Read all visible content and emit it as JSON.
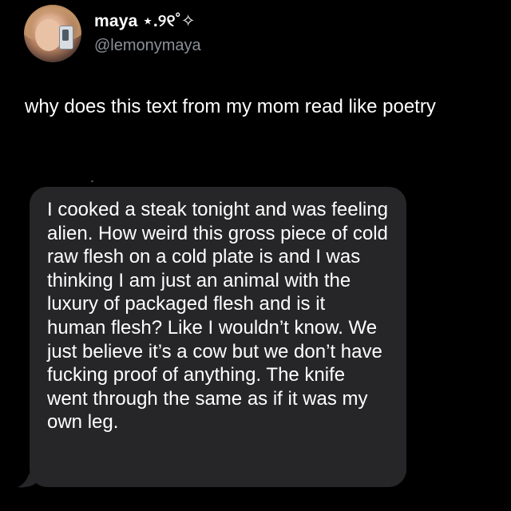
{
  "author": {
    "display_name": "maya ⋆.୨୧˚✧",
    "handle": "@lemonymaya",
    "avatar_icon": "profile-avatar-icon"
  },
  "tweet": {
    "text": "why does this text from my mom read like poetry"
  },
  "message_bubble": {
    "text": "I cooked a steak tonight and was feeling alien. How weird this gross piece of cold raw flesh on a cold plate is and I was thinking I am just an animal with the luxury of packaged flesh and is it human flesh? Like I wouldn’t know. We just believe it’s a cow but we don’t have fucking proof of anything. The knife went through the same as if it was my own leg.",
    "bubble_color": "#262628"
  },
  "colors": {
    "background": "#000000",
    "text_primary": "#ffffff",
    "text_secondary": "#8b9097"
  }
}
